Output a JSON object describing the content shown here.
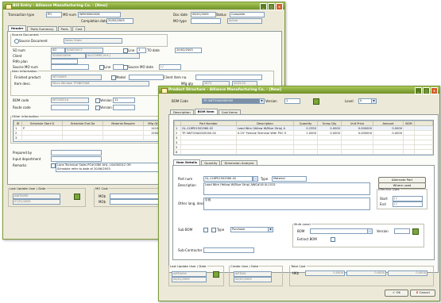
{
  "back": {
    "title": "Bill Entry - Alliance Manufacturing Co. - [New]",
    "row1": {
      "transaction_type_label": "Transaction type",
      "transaction_type": "PO",
      "mo_num_label": "MO num",
      "mo_num": "WMO6000026",
      "doc_date_label": "Doc date",
      "doc_date": "06/01/2005",
      "status_label": "Status",
      "status": "Complete"
    },
    "row2": {
      "completion_date_label": "Completion date",
      "completion_date": "20/02/2003",
      "mo_type_label": "MO type",
      "mo_type": "",
      "state": "Active"
    },
    "tabs": [
      "Header",
      "Parts Summary",
      "Parts",
      "Cost"
    ],
    "source_document": {
      "legend": "Source Document",
      "radio_label": "Source Document",
      "value": "Sales Order"
    },
    "so_num": {
      "label": "SO num",
      "value": "SO",
      "code": "S/A003017",
      "line_label": "Line",
      "line": "1",
      "to_date_label": "TO date",
      "to_date": "20/02/2003"
    },
    "client": {
      "label": "Client",
      "code": "5000400096",
      "name": "ALLCOMM (H.K.)"
    },
    "pdfo_plan_label": "Pdfo plan",
    "source_mo": {
      "label": "Source MO num",
      "line_label": "Line",
      "date_label": "Source MO date",
      "date": "/ /"
    },
    "item_info": {
      "legend": "Item Information",
      "finished_product_label": "Finished product",
      "finished_product": "WTO0005",
      "model_label": "Model",
      "client_item_label": "Client item no.",
      "item_desc_label": "Item desc.",
      "item_desc": "Micro Window TP3BKF4K8",
      "mfg_qty_label": "Mfg qty",
      "mfg_qty": "2873",
      "mfg_qty2": "2003.00"
    },
    "bom_code": {
      "label": "BOM code",
      "value": "WTO0021A",
      "version_label": "Version",
      "version": "11"
    },
    "route_code": {
      "label": "Route code",
      "version_label": "Version"
    },
    "other_info": {
      "legend": "Other information",
      "headers": [
        "ID",
        "Schedule Start D",
        "Schedule End Da",
        "Material Require",
        "Mfg Qty"
      ],
      "rows": [
        [
          "1",
          "P",
          "",
          "",
          "1410.00"
        ],
        [
          "2",
          "",
          "",
          "",
          "1500.00"
        ],
        [
          "3",
          "",
          "",
          "",
          "0"
        ]
      ]
    },
    "prepared_by_label": "Prepared by",
    "input_department_label": "Input department",
    "remarks": {
      "label": "Remarks",
      "line1": "Lane Technical Sales PO#1080 AHL, LS4000012 OR",
      "line2": "Schedule refer to date of 20/06/2003"
    },
    "footer": {
      "last_update_label": "Last Update User / Date",
      "last_user": "ANITA090",
      "last_date": "07/01/2005",
      "mo_cost_label": "MO Cost",
      "mo1": "MO$",
      "mo2": "MO$"
    }
  },
  "front": {
    "title": "Product Structure - Alliance Manufacturing Co. - [New]",
    "bom_code_label": "BOM Code",
    "bom_code": "TP-3WTO0A0000000",
    "version_label": "Version",
    "version": "1",
    "level_label": "Level",
    "level": "0",
    "tabs": [
      "Description",
      "BOM Item",
      "Cost Items"
    ],
    "grid": {
      "headers": [
        "",
        "Part Number",
        "Description",
        "Quantity",
        "Scrap Qty",
        "Unit Price",
        "Amount",
        "BOM"
      ],
      "rows": [
        [
          "1",
          "GL-118P01502560-02",
          "Lead Wire (Yellow W/Blue Strip) A",
          "0.2350",
          "0.0000",
          "0.000000",
          "0.0000",
          ""
        ],
        [
          "2",
          "TP-3WTO0A0020000-02",
          "0.25\" Female Terminal With PVC S",
          "1.0000",
          "0.0000",
          "0.000000",
          "0.0000",
          ""
        ],
        [
          "3",
          "",
          "",
          "",
          "",
          "",
          "",
          ""
        ],
        [
          "4",
          "",
          "",
          "",
          "",
          "",
          "",
          ""
        ],
        [
          "5",
          "",
          "",
          "",
          "",
          "",
          "",
          ""
        ],
        [
          "6",
          "",
          "",
          "",
          "",
          "",
          "",
          ""
        ]
      ]
    },
    "sub_tabs": [
      "Item Details",
      "Quantity",
      "Dimension Analysis"
    ],
    "part_num_label": "Part num",
    "part_num": "GL-118P01502560-02",
    "type_label": "Type",
    "type": "Material",
    "description_label": "Description",
    "description": "Lead Wire (Yellow W/Blue Strip) AWG#18 UL1015",
    "other_lang_label": "Other lang. description",
    "other_lang": "引线",
    "alternate_part": "Alternate Part",
    "where_used": "Where used",
    "effective_label": "Effective Date",
    "start_label": "Start",
    "start": "/ /",
    "end_label": "End",
    "end": "/ /",
    "sub_bom_label": "Sub BOM",
    "sub_type_label": "Type",
    "sub_type": "Purchase",
    "multi_level": {
      "legend": "Multi-Level",
      "bom_label": "BOM",
      "version_label": "Version",
      "extract_label": "Extract BOM"
    },
    "sub_contractor_label": "Sub-Contractor",
    "footer": {
      "last_update_label": "Last Update User / Date",
      "last_user": "AMTA090",
      "last_date": "04/01/2005",
      "create_label": "Create User / Date",
      "create_user": "WTENG",
      "create_date": "04/07/2003",
      "total_cost_label": "Total Cost",
      "cost_currency": "HK$",
      "cost1": "0.0000",
      "cost2": "0.0000",
      "cost3": "0.0000"
    },
    "ok": "OK",
    "cancel": "Cancel"
  }
}
